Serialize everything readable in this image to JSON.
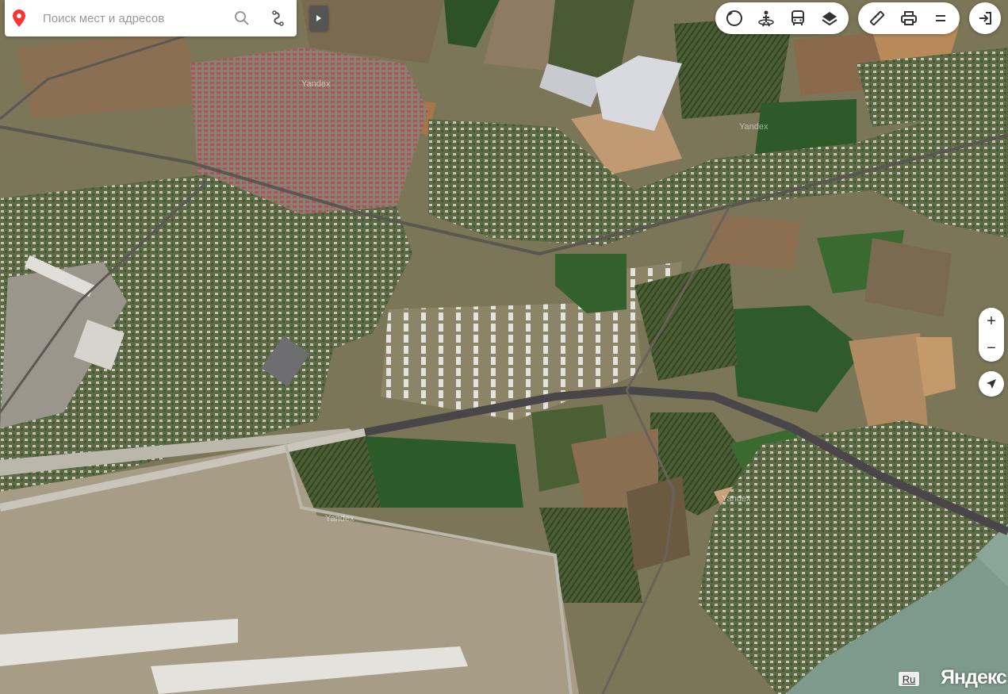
{
  "search": {
    "placeholder": "Поиск мест и адресов"
  },
  "toolbar_left": {
    "icons": [
      "traffic-icon",
      "panorama-icon",
      "transport-icon",
      "layers-icon"
    ]
  },
  "toolbar_right": {
    "icons": [
      "ruler-icon",
      "print-icon",
      "menu-icon"
    ]
  },
  "zoom": {
    "in_label": "+",
    "out_label": "−"
  },
  "language": "Ru",
  "logo": "Яндекс",
  "watermarks": [
    "Yandex",
    "Yandex",
    "Yandex",
    "Yandex"
  ],
  "colors": {
    "accent_red": "#ff3333",
    "panel_bg": "#ffffff"
  }
}
